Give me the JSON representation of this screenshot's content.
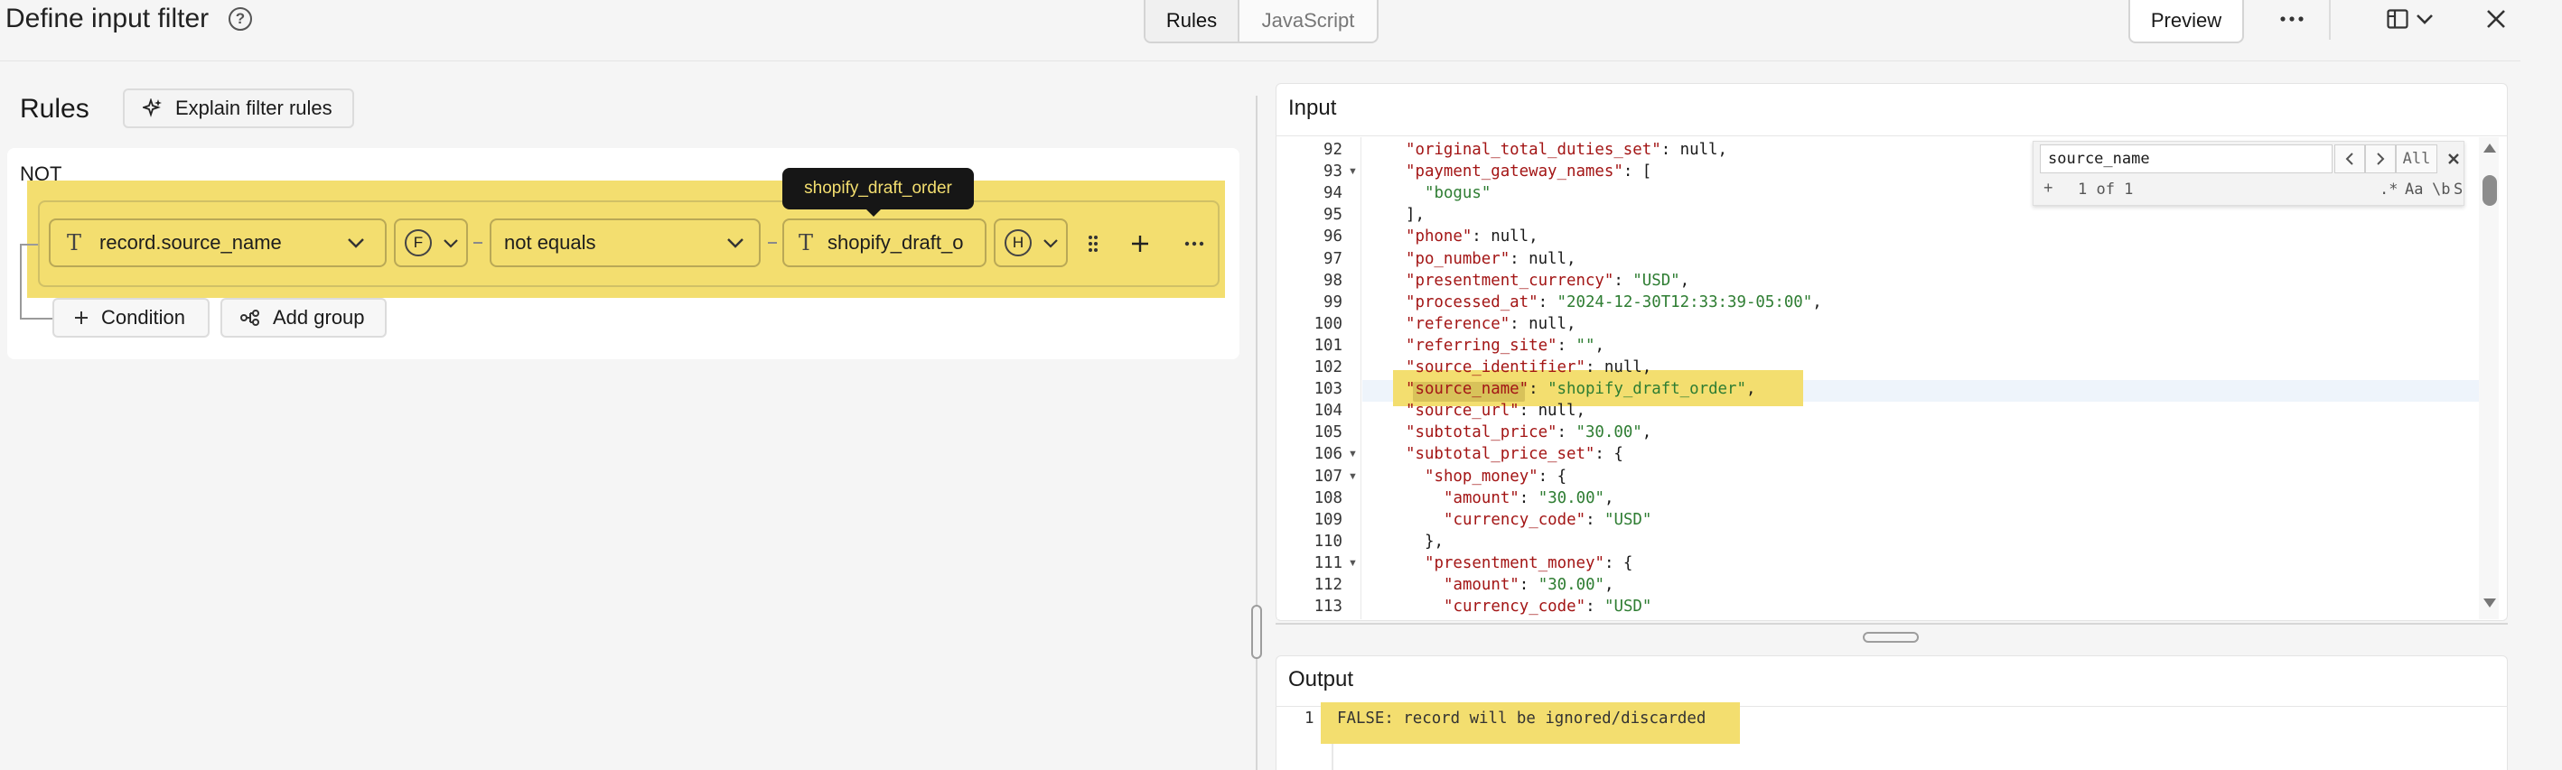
{
  "header": {
    "title": "Define input filter",
    "tabs": [
      {
        "label": "Rules",
        "active": true
      },
      {
        "label": "JavaScript",
        "active": false
      }
    ],
    "preview_label": "Preview"
  },
  "rules": {
    "title": "Rules",
    "explain_label": "Explain filter rules",
    "not_label": "NOT",
    "field_value": "record.source_name",
    "field_type_badge": "F",
    "operator_value": "not equals",
    "compare_value": "shopify_draft_o",
    "compare_type_badge": "H",
    "tooltip": "shopify_draft_order",
    "condition_label": "Condition",
    "add_group_label": "Add group"
  },
  "input": {
    "title": "Input",
    "lines": [
      {
        "n": "92",
        "fold": false,
        "indent": 1,
        "key": "original_total_duties_set",
        "rest": ": null,"
      },
      {
        "n": "93",
        "fold": true,
        "indent": 1,
        "key": "payment_gateway_names",
        "rest": ": ["
      },
      {
        "n": "94",
        "fold": false,
        "indent": 2,
        "str": "\"bogus\""
      },
      {
        "n": "95",
        "fold": false,
        "indent": 1,
        "plain": "],"
      },
      {
        "n": "96",
        "fold": false,
        "indent": 1,
        "key": "phone",
        "rest": ": null,"
      },
      {
        "n": "97",
        "fold": false,
        "indent": 1,
        "key": "po_number",
        "rest": ": null,"
      },
      {
        "n": "98",
        "fold": false,
        "indent": 1,
        "key": "presentment_currency",
        "rest": ": ",
        "val": "\"USD\"",
        "tail": ","
      },
      {
        "n": "99",
        "fold": false,
        "indent": 1,
        "key": "processed_at",
        "rest": ": ",
        "val": "\"2024-12-30T12:33:39-05:00\"",
        "tail": ","
      },
      {
        "n": "100",
        "fold": false,
        "indent": 1,
        "key": "reference",
        "rest": ": null,"
      },
      {
        "n": "101",
        "fold": false,
        "indent": 1,
        "key": "referring_site",
        "rest": ": ",
        "val": "\"\"",
        "tail": ","
      },
      {
        "n": "102",
        "fold": false,
        "indent": 1,
        "key": "source_identifier",
        "rest": ": null,"
      },
      {
        "n": "103",
        "fold": false,
        "indent": 1,
        "key": "source_name",
        "rest": ": ",
        "val": "\"shopify_draft_order\"",
        "tail": ","
      },
      {
        "n": "104",
        "fold": false,
        "indent": 1,
        "key": "source_url",
        "rest": ": null,"
      },
      {
        "n": "105",
        "fold": false,
        "indent": 1,
        "key": "subtotal_price",
        "rest": ": ",
        "val": "\"30.00\"",
        "tail": ","
      },
      {
        "n": "106",
        "fold": true,
        "indent": 1,
        "key": "subtotal_price_set",
        "rest": ": {"
      },
      {
        "n": "107",
        "fold": true,
        "indent": 2,
        "key": "shop_money",
        "rest": ": {"
      },
      {
        "n": "108",
        "fold": false,
        "indent": 3,
        "key": "amount",
        "rest": ": ",
        "val": "\"30.00\"",
        "tail": ","
      },
      {
        "n": "109",
        "fold": false,
        "indent": 3,
        "key": "currency_code",
        "rest": ": ",
        "val": "\"USD\"",
        "tail": ""
      },
      {
        "n": "110",
        "fold": false,
        "indent": 2,
        "plain": "},"
      },
      {
        "n": "111",
        "fold": true,
        "indent": 2,
        "key": "presentment_money",
        "rest": ": {"
      },
      {
        "n": "112",
        "fold": false,
        "indent": 3,
        "key": "amount",
        "rest": ": ",
        "val": "\"30.00\"",
        "tail": ","
      },
      {
        "n": "113",
        "fold": false,
        "indent": 3,
        "key": "currency_code",
        "rest": ": ",
        "val": "\"USD\"",
        "tail": ""
      }
    ],
    "find": {
      "query": "source_name",
      "all_label": "All",
      "count": "1 of 1",
      "regex_label": ".*",
      "case_label": "Aa",
      "word_label": "\\b",
      "selection_label": "S"
    }
  },
  "output": {
    "title": "Output",
    "line_number": "1",
    "text": "FALSE: record will be ignored/discarded"
  }
}
